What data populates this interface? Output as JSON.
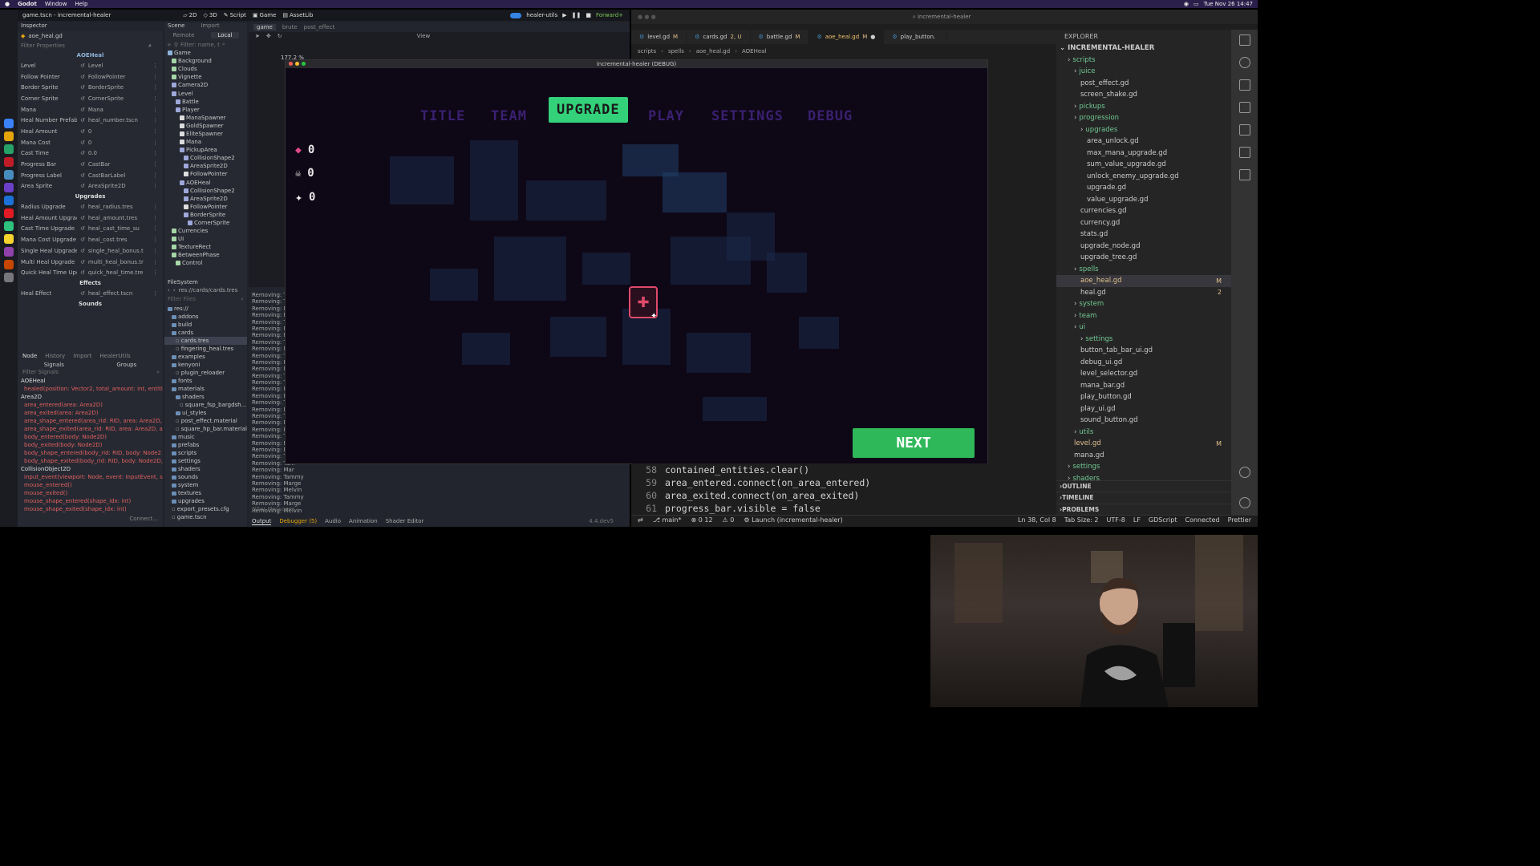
{
  "menubar": {
    "app": "Godot",
    "items": [
      "Window",
      "Help"
    ],
    "clock": "Tue Nov 26 14:47"
  },
  "godot": {
    "window_title": "game.tscn - incremental-healer",
    "modes": [
      "2D",
      "3D",
      "Script",
      "Game",
      "AssetLib"
    ],
    "run_config": "healer-utils",
    "renderer": "Forward+",
    "inspector": {
      "title": "Inspector",
      "file": "aoe_heal.gd",
      "filter": "Filter Properties",
      "node": "AOEHeal",
      "props": [
        {
          "label": "Level",
          "value": "Level"
        },
        {
          "label": "Follow Pointer",
          "value": "FollowPointer"
        },
        {
          "label": "Border Sprite",
          "value": "BorderSprite"
        },
        {
          "label": "Corner Sprite",
          "value": "CornerSprite"
        },
        {
          "label": "Mana",
          "value": "Mana"
        },
        {
          "label": "Heal Number Prefab",
          "value": "heal_number.tscn"
        },
        {
          "label": "Heal Amount",
          "value": "0"
        },
        {
          "label": "Mana Cost",
          "value": "0"
        },
        {
          "label": "Cast Time",
          "value": "0.0"
        },
        {
          "label": "Progress Bar",
          "value": "CastBar"
        },
        {
          "label": "Progress Label",
          "value": "CastBarLabel"
        },
        {
          "label": "Area Sprite",
          "value": "AreaSprite2D"
        }
      ],
      "upgrades_header": "Upgrades",
      "upgrades": [
        {
          "label": "Radius Upgrade",
          "value": "heal_radius.tres"
        },
        {
          "label": "Heal Amount Upgrade",
          "value": "heal_amount.tres"
        },
        {
          "label": "Cast Time Upgrade",
          "value": "heal_cast_time_su"
        },
        {
          "label": "Mana Cost Upgrade",
          "value": "heal_cost.tres"
        },
        {
          "label": "Single Heal Upgrade",
          "value": "single_heal_bonus.t"
        },
        {
          "label": "Multi Heal Upgrade",
          "value": "multi_heal_bonus.tr"
        },
        {
          "label": "Quick Heal Time Upgra",
          "value": "quick_heal_time.tre"
        }
      ],
      "effects_header": "Effects",
      "effects": [
        {
          "label": "Heal Effect",
          "value": "heal_effect.tscn"
        }
      ],
      "sounds_header": "Sounds"
    },
    "signals": {
      "tabs": [
        "Node",
        "History",
        "Import",
        "HealerUtils"
      ],
      "subtabs": [
        "Signals",
        "Groups"
      ],
      "filter": "Filter Signals",
      "rows": [
        {
          "text": "AOEHeal",
          "node": true
        },
        {
          "text": "healed(position: Vector2, total_amount: int, entiti",
          "node": false
        },
        {
          "text": "Area2D",
          "node": true
        },
        {
          "text": "area_entered(area: Area2D)",
          "node": false
        },
        {
          "text": "area_exited(area: Area2D)",
          "node": false
        },
        {
          "text": "area_shape_entered(area_rid: RID, area: Area2D,",
          "node": false
        },
        {
          "text": "area_shape_exited(area_rid: RID, area: Area2D, a",
          "node": false
        },
        {
          "text": "body_entered(body: Node2D)",
          "node": false
        },
        {
          "text": "body_exited(body: Node2D)",
          "node": false
        },
        {
          "text": "body_shape_entered(body_rid: RID, body: Node2",
          "node": false
        },
        {
          "text": "body_shape_exited(body_rid: RID, body: Node2D,",
          "node": false
        },
        {
          "text": "CollisionObject2D",
          "node": true
        },
        {
          "text": "input_event(viewport: Node, event: InputEvent, s",
          "node": false
        },
        {
          "text": "mouse_entered()",
          "node": false
        },
        {
          "text": "mouse_exited()",
          "node": false
        },
        {
          "text": "mouse_shape_entered(shape_idx: int)",
          "node": false
        },
        {
          "text": "mouse_shape_exited(shape_idx: int)",
          "node": false
        }
      ],
      "connect": "Connect..."
    },
    "scene": {
      "title": "Scene",
      "import": "Import",
      "tabs": [
        "Remote",
        "Local"
      ],
      "filter": "Filter: name, t",
      "nodes": [
        {
          "name": "Game",
          "indent": 0,
          "color": "#8eb3d9"
        },
        {
          "name": "Background",
          "indent": 1,
          "color": "#a5d6a7"
        },
        {
          "name": "Clouds",
          "indent": 1,
          "color": "#a5d6a7"
        },
        {
          "name": "Vignette",
          "indent": 1,
          "color": "#a5d6a7"
        },
        {
          "name": "Camera2D",
          "indent": 1,
          "color": "#9fa8da"
        },
        {
          "name": "Level",
          "indent": 1,
          "color": "#9fa8da"
        },
        {
          "name": "Battle",
          "indent": 2,
          "color": "#9fa8da"
        },
        {
          "name": "Player",
          "indent": 2,
          "color": "#9fa8da"
        },
        {
          "name": "ManaSpawner",
          "indent": 3,
          "color": "#dddddd"
        },
        {
          "name": "GoldSpawner",
          "indent": 3,
          "color": "#dddddd"
        },
        {
          "name": "EliteSpawner",
          "indent": 3,
          "color": "#dddddd"
        },
        {
          "name": "Mana",
          "indent": 3,
          "color": "#dddddd"
        },
        {
          "name": "PickupArea",
          "indent": 3,
          "color": "#9fa8da"
        },
        {
          "name": "CollisionShape2",
          "indent": 4,
          "color": "#9fa8da"
        },
        {
          "name": "AreaSprite2D",
          "indent": 4,
          "color": "#9fa8da"
        },
        {
          "name": "FollowPointer",
          "indent": 4,
          "color": "#dddddd"
        },
        {
          "name": "AOEHeal",
          "indent": 3,
          "color": "#9fa8da"
        },
        {
          "name": "CollisionShape2",
          "indent": 4,
          "color": "#9fa8da"
        },
        {
          "name": "AreaSprite2D",
          "indent": 4,
          "color": "#9fa8da"
        },
        {
          "name": "FollowPointer",
          "indent": 4,
          "color": "#dddddd"
        },
        {
          "name": "BorderSprite",
          "indent": 4,
          "color": "#9fa8da"
        },
        {
          "name": "CornerSprite",
          "indent": 5,
          "color": "#9fa8da"
        },
        {
          "name": "Currencies",
          "indent": 1,
          "color": "#a5d6a7"
        },
        {
          "name": "UI",
          "indent": 1,
          "color": "#a5d6a7"
        },
        {
          "name": "TextureRect",
          "indent": 1,
          "color": "#a5d6a7"
        },
        {
          "name": "BetweenPhase",
          "indent": 1,
          "color": "#a5d6a7"
        },
        {
          "name": "Control",
          "indent": 2,
          "color": "#a5d6a7"
        }
      ]
    },
    "filesystem": {
      "title": "FileSystem",
      "path": "res://cards/cards.tres",
      "filter": "Filter Files",
      "items": [
        {
          "name": "res://",
          "indent": 0,
          "folder": true
        },
        {
          "name": "addons",
          "indent": 1,
          "folder": true
        },
        {
          "name": "build",
          "indent": 1,
          "folder": true
        },
        {
          "name": "cards",
          "indent": 1,
          "folder": true
        },
        {
          "name": "cards.tres",
          "indent": 2,
          "folder": false
        },
        {
          "name": "fingering_heal.tres",
          "indent": 2,
          "folder": false
        },
        {
          "name": "examples",
          "indent": 1,
          "folder": true
        },
        {
          "name": "kenyoni",
          "indent": 1,
          "folder": true
        },
        {
          "name": "plugin_reloader",
          "indent": 2,
          "folder": false
        },
        {
          "name": "fonts",
          "indent": 1,
          "folder": true
        },
        {
          "name": "materials",
          "indent": 1,
          "folder": true
        },
        {
          "name": "shaders",
          "indent": 2,
          "folder": true
        },
        {
          "name": "square_fsp_bargdsh...",
          "indent": 3,
          "folder": false
        },
        {
          "name": "ui_styles",
          "indent": 2,
          "folder": true
        },
        {
          "name": "post_effect.material",
          "indent": 2,
          "folder": false
        },
        {
          "name": "square_hp_bar.material",
          "indent": 2,
          "folder": false
        },
        {
          "name": "music",
          "indent": 1,
          "folder": true
        },
        {
          "name": "prefabs",
          "indent": 1,
          "folder": true
        },
        {
          "name": "scripts",
          "indent": 1,
          "folder": true
        },
        {
          "name": "settings",
          "indent": 1,
          "folder": true
        },
        {
          "name": "shaders",
          "indent": 1,
          "folder": true
        },
        {
          "name": "sounds",
          "indent": 1,
          "folder": true
        },
        {
          "name": "system",
          "indent": 1,
          "folder": true
        },
        {
          "name": "textures",
          "indent": 1,
          "folder": true
        },
        {
          "name": "upgrades",
          "indent": 1,
          "folder": true
        },
        {
          "name": "export_presets.cfg",
          "indent": 1,
          "folder": false
        },
        {
          "name": "game.tscn",
          "indent": 1,
          "folder": false
        }
      ]
    },
    "viewport": {
      "tab": "game",
      "tabs2": [
        "brute",
        "post_effect"
      ],
      "zoom": "177.2 %",
      "view": "View"
    },
    "output": {
      "lines": [
        "Removing: Tam",
        "Removing: Tam",
        "Removing: Mel",
        "Removing: Mar",
        "Removing: Tam",
        "Removing: Mar",
        "Removing: Mel",
        "Removing: Tam",
        "Removing: Mar",
        "Removing: Tam",
        "Removing: Mel",
        "Removing: Mar",
        "Removing: Tam",
        "Removing: Tam",
        "Removing: Mel",
        "Removing: Mar",
        "Removing: Tam",
        "Removing: Mel",
        "Removing: Tam",
        "Removing: Mar",
        "Removing: Mel",
        "Removing: Tam",
        "Removing: Mar",
        "Removing: Mel",
        "Removing: Tam",
        "Removing: Tam",
        "Removing: Mar",
        "Removing: Tammy",
        "Removing: Marge",
        "Removing: Melvin",
        "Removing: Tammy",
        "Removing: Marge",
        "Removing: Melvin"
      ],
      "filter": "Filter Messages",
      "bottom_tabs": [
        "Output",
        "Debugger (5)",
        "Audio",
        "Animation",
        "Shader Editor"
      ],
      "version": "4.4.dev5"
    }
  },
  "game": {
    "window_title": "incremental-healer (DEBUG)",
    "tabs": [
      "TITLE",
      "TEAM",
      "UPGRADE",
      "PLAY",
      "SETTINGS",
      "DEBUG"
    ],
    "active_tab": "UPGRADE",
    "stats": [
      {
        "icon": "mana-crystal-icon",
        "value": "0"
      },
      {
        "icon": "skull-icon",
        "value": "0"
      },
      {
        "icon": "sparkle-icon",
        "value": "0"
      }
    ],
    "next": "NEXT",
    "colors": {
      "tab": "#3a2070",
      "active": "#33d17a",
      "next": "#2fb85a",
      "bg": "#0e0716",
      "node": "#e04a6a"
    }
  },
  "vscode": {
    "window_title": "incremental-healer",
    "tabs": [
      {
        "name": "level.gd",
        "mark": "M"
      },
      {
        "name": "cards.gd",
        "mark": "2, U"
      },
      {
        "name": "battle.gd",
        "mark": "M"
      },
      {
        "name": "aoe_heal.gd",
        "mark": "M"
      },
      {
        "name": "play_button.",
        "mark": ""
      }
    ],
    "active_tab": "aoe_heal.gd",
    "breadcrumb": [
      "scripts",
      "spells",
      "aoe_heal.gd",
      "AOEHeal"
    ],
    "code": [
      {
        "no": "58",
        "text": "contained_entities.clear()"
      },
      {
        "no": "59",
        "text": "area_entered.connect(on_area_entered)"
      },
      {
        "no": "60",
        "text": "area_exited.connect(on_area_exited)"
      },
      {
        "no": "61",
        "text": "progress_bar.visible = false"
      }
    ],
    "explorer": {
      "title": "EXPLORER",
      "root": "INCREMENTAL-HEALER",
      "items": [
        {
          "name": "scripts",
          "indent": 1,
          "folder": true,
          "badge": ""
        },
        {
          "name": "juice",
          "indent": 2,
          "folder": true,
          "badge": ""
        },
        {
          "name": "post_effect.gd",
          "indent": 3,
          "folder": false,
          "badge": ""
        },
        {
          "name": "screen_shake.gd",
          "indent": 3,
          "folder": false,
          "badge": ""
        },
        {
          "name": "pickups",
          "indent": 2,
          "folder": true,
          "badge": ""
        },
        {
          "name": "progression",
          "indent": 2,
          "folder": true,
          "badge": ""
        },
        {
          "name": "upgrades",
          "indent": 3,
          "folder": true,
          "badge": ""
        },
        {
          "name": "area_unlock.gd",
          "indent": 4,
          "folder": false,
          "badge": ""
        },
        {
          "name": "max_mana_upgrade.gd",
          "indent": 4,
          "folder": false,
          "badge": ""
        },
        {
          "name": "sum_value_upgrade.gd",
          "indent": 4,
          "folder": false,
          "badge": ""
        },
        {
          "name": "unlock_enemy_upgrade.gd",
          "indent": 4,
          "folder": false,
          "badge": ""
        },
        {
          "name": "upgrade.gd",
          "indent": 4,
          "folder": false,
          "badge": ""
        },
        {
          "name": "value_upgrade.gd",
          "indent": 4,
          "folder": false,
          "badge": ""
        },
        {
          "name": "currencies.gd",
          "indent": 3,
          "folder": false,
          "badge": ""
        },
        {
          "name": "currency.gd",
          "indent": 3,
          "folder": false,
          "badge": ""
        },
        {
          "name": "stats.gd",
          "indent": 3,
          "folder": false,
          "badge": ""
        },
        {
          "name": "upgrade_node.gd",
          "indent": 3,
          "folder": false,
          "badge": ""
        },
        {
          "name": "upgrade_tree.gd",
          "indent": 3,
          "folder": false,
          "badge": ""
        },
        {
          "name": "spells",
          "indent": 2,
          "folder": true,
          "badge": ""
        },
        {
          "name": "aoe_heal.gd",
          "indent": 3,
          "folder": false,
          "badge": "M"
        },
        {
          "name": "heal.gd",
          "indent": 3,
          "folder": false,
          "badge": "2"
        },
        {
          "name": "system",
          "indent": 2,
          "folder": true,
          "badge": ""
        },
        {
          "name": "team",
          "indent": 2,
          "folder": true,
          "badge": ""
        },
        {
          "name": "ui",
          "indent": 2,
          "folder": true,
          "badge": ""
        },
        {
          "name": "settings",
          "indent": 3,
          "folder": true,
          "badge": ""
        },
        {
          "name": "button_tab_bar_ui.gd",
          "indent": 3,
          "folder": false,
          "badge": ""
        },
        {
          "name": "debug_ui.gd",
          "indent": 3,
          "folder": false,
          "badge": ""
        },
        {
          "name": "level_selector.gd",
          "indent": 3,
          "folder": false,
          "badge": ""
        },
        {
          "name": "mana_bar.gd",
          "indent": 3,
          "folder": false,
          "badge": ""
        },
        {
          "name": "play_button.gd",
          "indent": 3,
          "folder": false,
          "badge": ""
        },
        {
          "name": "play_ui.gd",
          "indent": 3,
          "folder": false,
          "badge": ""
        },
        {
          "name": "sound_button.gd",
          "indent": 3,
          "folder": false,
          "badge": ""
        },
        {
          "name": "utils",
          "indent": 2,
          "folder": true,
          "badge": ""
        },
        {
          "name": "level.gd",
          "indent": 2,
          "folder": false,
          "badge": "M"
        },
        {
          "name": "mana.gd",
          "indent": 2,
          "folder": false,
          "badge": ""
        },
        {
          "name": "settings",
          "indent": 1,
          "folder": true,
          "badge": ""
        },
        {
          "name": "shaders",
          "indent": 1,
          "folder": true,
          "badge": ""
        }
      ],
      "sections": [
        "OUTLINE",
        "TIMELINE",
        "PROBLEMS"
      ]
    },
    "status": {
      "branch": "main*",
      "problems": "0 12",
      "warnings": "0",
      "launch": "Launch (incremental-healer)",
      "position": "Ln 38, Col 8",
      "tabsize": "Tab Size: 2",
      "encoding": "UTF-8",
      "eol": "LF",
      "lang": "GDScript",
      "connected": "Connected",
      "prettier": "Prettier"
    }
  }
}
